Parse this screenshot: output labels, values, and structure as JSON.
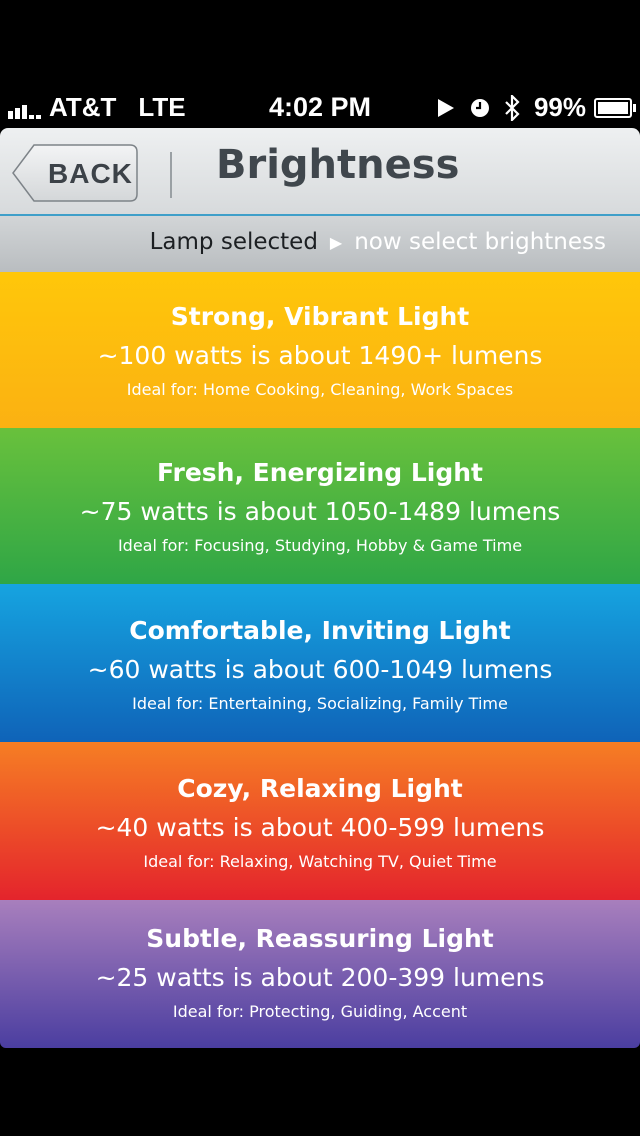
{
  "status_bar": {
    "carrier": "AT&T",
    "network": "LTE",
    "time": "4:02 PM",
    "battery": "99%",
    "icons": [
      "signal-icon",
      "play-icon",
      "clock-icon",
      "bluetooth-icon",
      "battery-icon"
    ]
  },
  "nav": {
    "back_label": "BACK",
    "title": "Brightness"
  },
  "subheader": {
    "done_step": "Lamp selected",
    "next_step": "now select brightness"
  },
  "options": [
    {
      "title": "Strong, Vibrant Light",
      "watts": "~100 watts is about 1490+ lumens",
      "ideal": "Ideal for: Home Cooking, Cleaning, Work Spaces",
      "color": "#fdbd0e"
    },
    {
      "title": "Fresh, Energizing Light",
      "watts": "~75 watts is about 1050-1489 lumens",
      "ideal": "Ideal for: Focusing, Studying, Hobby & Game Time",
      "color": "#4cb43f"
    },
    {
      "title": "Comfortable, Inviting Light",
      "watts": "~60 watts is about 600-1049 lumens",
      "ideal": "Ideal for: Entertaining, Socializing, Family Time",
      "color": "#1384cc"
    },
    {
      "title": "Cozy, Relaxing Light",
      "watts": "~40 watts is about 400-599 lumens",
      "ideal": "Ideal for: Relaxing, Watching TV, Quiet Time",
      "color": "#ed5028"
    },
    {
      "title": "Subtle, Reassuring Light",
      "watts": "~25 watts is about 200-399 lumens",
      "ideal": "Ideal for: Protecting, Guiding, Accent",
      "color": "#7a5fb0"
    }
  ]
}
